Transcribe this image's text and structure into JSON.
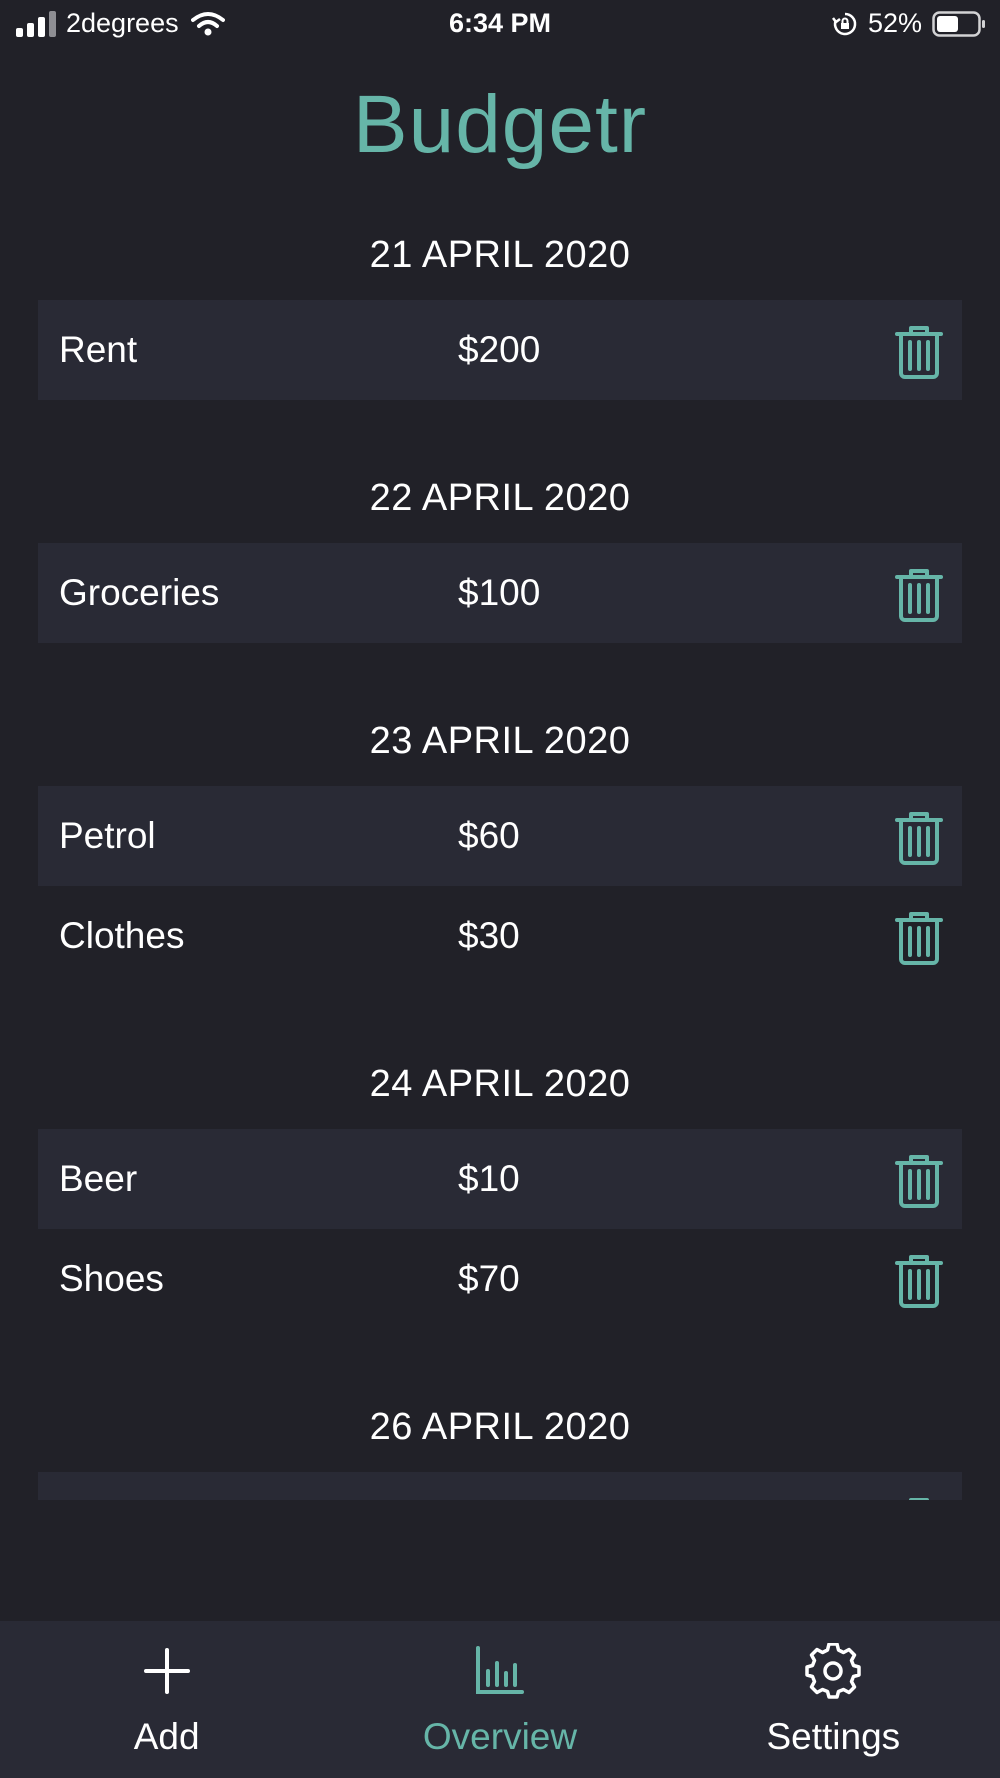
{
  "status_bar": {
    "carrier": "2degrees",
    "time": "6:34 PM",
    "battery": "52%",
    "battery_level": 0.52
  },
  "app": {
    "title": "Budgetr"
  },
  "groups": [
    {
      "date": "21 APRIL 2020",
      "items": [
        {
          "name": "Rent",
          "amount": "$200"
        }
      ]
    },
    {
      "date": "22 APRIL 2020",
      "items": [
        {
          "name": "Groceries",
          "amount": "$100"
        }
      ]
    },
    {
      "date": "23 APRIL 2020",
      "items": [
        {
          "name": "Petrol",
          "amount": "$60"
        },
        {
          "name": "Clothes",
          "amount": "$30"
        }
      ]
    },
    {
      "date": "24 APRIL 2020",
      "items": [
        {
          "name": "Beer",
          "amount": "$10"
        },
        {
          "name": "Shoes",
          "amount": "$70"
        }
      ]
    },
    {
      "date": "26 APRIL 2020",
      "items": [
        {
          "name": "",
          "amount": ""
        }
      ]
    }
  ],
  "tab_bar": {
    "tabs": [
      {
        "label": "Add",
        "icon": "plus-icon",
        "active": false
      },
      {
        "label": "Overview",
        "icon": "bar-chart-icon",
        "active": true
      },
      {
        "label": "Settings",
        "icon": "gear-icon",
        "active": false
      }
    ]
  },
  "colors": {
    "background": "#212128",
    "row_shade": "#292a35",
    "accent": "#66b5a8",
    "text": "#ffffff"
  }
}
